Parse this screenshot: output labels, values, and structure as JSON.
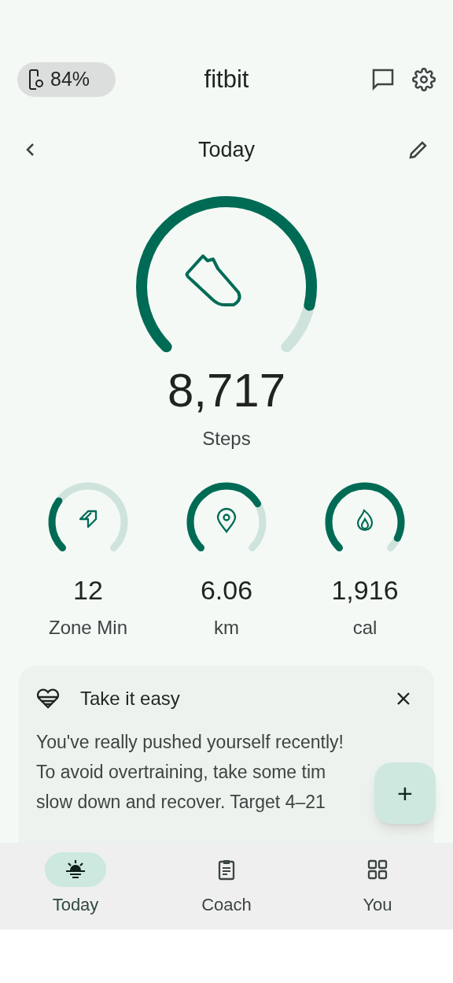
{
  "header": {
    "battery": "84%",
    "title": "fitbit"
  },
  "date_bar": {
    "title": "Today"
  },
  "main_goal": {
    "value": "8,717",
    "label": "Steps"
  },
  "stats": [
    {
      "kind": "zone",
      "value": "12",
      "label": "Zone Min"
    },
    {
      "kind": "distance",
      "value": "6.06",
      "label": "km"
    },
    {
      "kind": "calories",
      "value": "1,916",
      "label": "cal"
    }
  ],
  "card": {
    "title": "Take it easy",
    "lines": [
      "You've really pushed yourself recently!",
      "To avoid overtraining, take some tim",
      "slow down and recover. Target 4–21"
    ]
  },
  "fab": {
    "label": "+"
  },
  "nav": [
    {
      "kind": "today",
      "label": "Today",
      "selected": true
    },
    {
      "kind": "coach",
      "label": "Coach",
      "selected": false
    },
    {
      "kind": "you",
      "label": "You",
      "selected": false
    }
  ]
}
